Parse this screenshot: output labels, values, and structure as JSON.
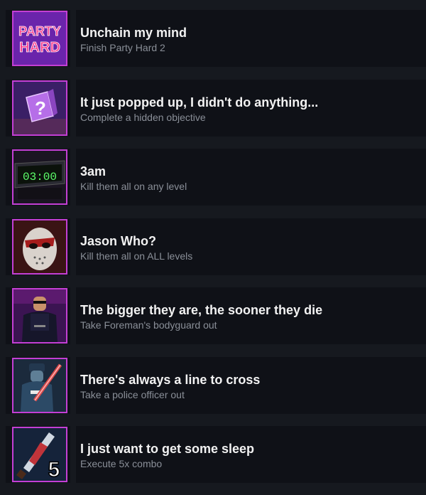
{
  "colors": {
    "frame": "#c33fd4",
    "row_bg": "#0f1117",
    "page_bg": "#16191f",
    "title": "#f2f2f2",
    "desc": "#8a8f98"
  },
  "achievements": [
    {
      "title": "Unchain my mind",
      "description": "Finish Party Hard 2",
      "icon": "party-hard-logo-icon",
      "icon_text": [
        "PARTY",
        "HARD"
      ]
    },
    {
      "title": "It just popped up, I didn't do anything...",
      "description": "Complete a hidden objective",
      "icon": "mystery-box-icon",
      "icon_text": [
        "?"
      ]
    },
    {
      "title": "3am",
      "description": "Kill them all on any level",
      "icon": "alarm-clock-icon",
      "icon_text": [
        "03:00"
      ]
    },
    {
      "title": "Jason Who?",
      "description": "Kill them all on ALL levels",
      "icon": "hockey-mask-icon"
    },
    {
      "title": "The bigger they are, the sooner they die",
      "description": "Take Foreman's bodyguard out",
      "icon": "bodyguard-icon"
    },
    {
      "title": "There's always a line to cross",
      "description": "Take a police officer out",
      "icon": "police-officer-icon"
    },
    {
      "title": "I just want to get some sleep",
      "description": "Execute 5x combo",
      "icon": "combo-knife-icon",
      "icon_text": [
        "5"
      ]
    }
  ]
}
